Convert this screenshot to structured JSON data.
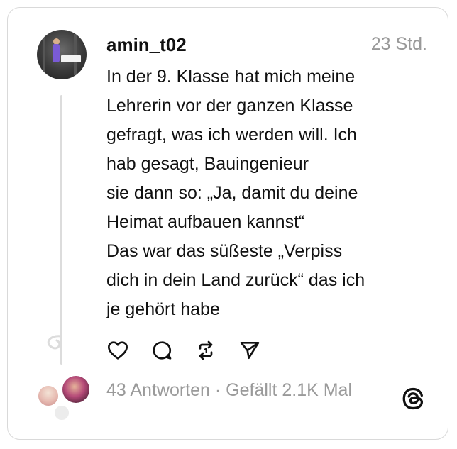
{
  "post": {
    "username": "amin_t02",
    "timestamp": "23 Std.",
    "text": "In der 9. Klasse hat mich meine\nLehrerin vor der ganzen Klasse\ngefragt, was ich werden will.  Ich\nhab gesagt, Bauingenieur\nsie dann so: „Ja, damit du deine\nHeimat aufbauen kannst“\nDas war das süßeste „Verpiss\ndich in dein Land zurück“ das ich\nje gehört habe"
  },
  "actions": {
    "icons": [
      "heart-icon",
      "comment-icon",
      "repost-icon",
      "send-icon"
    ]
  },
  "footer": {
    "replies": "43 Antworten",
    "separator": " · ",
    "likes": "Gefällt 2.1K Mal"
  },
  "colors": {
    "text": "#111111",
    "muted": "#999999",
    "border": "#d9d9d9",
    "thread_line": "#dcdcdc"
  }
}
